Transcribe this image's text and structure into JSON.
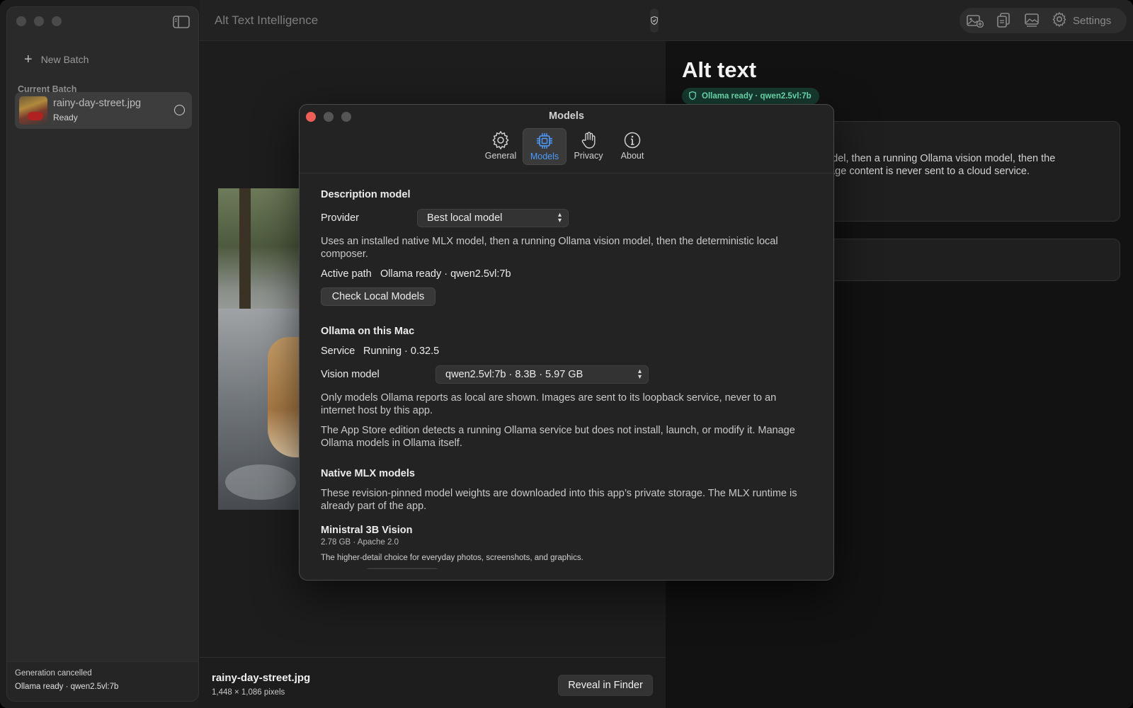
{
  "app": {
    "title": "Alt Text Intelligence"
  },
  "sidebar": {
    "new_batch_label": "New Batch",
    "section_label": "Current Batch",
    "items": [
      {
        "name": "rainy-day-street.jpg",
        "status": "Ready"
      }
    ],
    "footer": {
      "line1": "Generation cancelled",
      "line2": "Ollama ready · qwen2.5vl:7b"
    }
  },
  "toolbar": {
    "settings_label": "Settings",
    "icons": [
      "image-add-icon",
      "copy-icon",
      "image-icon",
      "gear-icon"
    ]
  },
  "preview": {
    "file_name": "rainy-day-street.jpg",
    "dimensions": "1,448 × 1,086 pixels",
    "reveal_label": "Reveal in Finder"
  },
  "right_pane": {
    "title": "Alt text",
    "badge": "Ollama ready · qwen2.5vl:7b",
    "card_text": "model, then a running Ollama vision model, then the Image content is never sent to a cloud service."
  },
  "dialog": {
    "title": "Models",
    "tabs": [
      {
        "label": "General",
        "icon": "gear-icon",
        "active": false
      },
      {
        "label": "Models",
        "icon": "chip-icon",
        "active": true
      },
      {
        "label": "Privacy",
        "icon": "hand-icon",
        "active": false
      },
      {
        "label": "About",
        "icon": "info-icon",
        "active": false
      }
    ],
    "description_model": {
      "heading": "Description model",
      "provider_label": "Provider",
      "provider_value": "Best local model",
      "provider_desc": "Uses an installed native MLX model, then a running Ollama vision model, then the deterministic local composer.",
      "active_path_label": "Active path",
      "active_path_value": "Ollama ready · qwen2.5vl:7b",
      "check_button": "Check Local Models"
    },
    "ollama": {
      "heading": "Ollama on this Mac",
      "service_label": "Service",
      "service_value": "Running · 0.32.5",
      "vision_label": "Vision model",
      "vision_value": "qwen2.5vl:7b · 8.3B · 5.97 GB",
      "desc1": "Only models Ollama reports as local are shown. Images are sent to its loopback service, never to an internet host by this app.",
      "desc2": "The App Store edition detects a running Ollama service but does not install, launch, or modify it. Manage Ollama models in Ollama itself."
    },
    "mlx": {
      "heading": "Native MLX models",
      "desc": "These revision-pinned model weights are downloaded into this app’s private storage. The MLX runtime is already part of the app.",
      "model_name": "Ministral 3B Vision",
      "model_meta": "2.78 GB · Apache 2.0",
      "model_desc": "The higher-detail choice for everyday photos, screenshots, and graphics."
    }
  },
  "colors": {
    "accent": "#4d9bff",
    "close_button": "#ed5f56",
    "badge_text": "#6fe3b8",
    "badge_bg": "#173a30"
  }
}
